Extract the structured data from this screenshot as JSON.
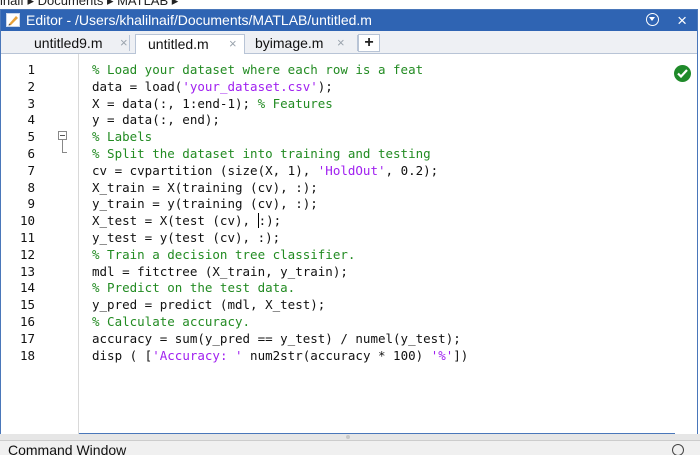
{
  "breadcrumb": "inaif  ▸  Documents  ▸  MATLAB  ▸",
  "editor": {
    "title": "Editor - /Users/khalilnaif/Documents/MATLAB/untitled.m",
    "close_glyph": "×"
  },
  "tabs": [
    {
      "label": "untitled9.m",
      "close": "×",
      "active": false
    },
    {
      "label": "untitled.m",
      "close": "×",
      "active": true
    },
    {
      "label": "byimage.m",
      "close": "×",
      "active": false
    }
  ],
  "new_tab_label": "+",
  "line_numbers": [
    "1",
    "2",
    "3",
    "4",
    "5",
    "6",
    "7",
    "8",
    "9",
    "10",
    "11",
    "12",
    "13",
    "14",
    "15",
    "16",
    "17",
    "18"
  ],
  "code": [
    {
      "segments": [
        {
          "t": "% Load your dataset where each row is a feat",
          "k": "c"
        }
      ]
    },
    {
      "segments": [
        {
          "t": "data = load(",
          "k": ""
        },
        {
          "t": "'your_dataset.csv'",
          "k": "s"
        },
        {
          "t": ");",
          "k": ""
        }
      ]
    },
    {
      "segments": [
        {
          "t": "X = data(:, 1:end-1); ",
          "k": ""
        },
        {
          "t": "% Features",
          "k": "c"
        }
      ]
    },
    {
      "segments": [
        {
          "t": "y = data(:, end);",
          "k": ""
        }
      ]
    },
    {
      "segments": [
        {
          "t": "% Labels",
          "k": "c"
        }
      ]
    },
    {
      "segments": [
        {
          "t": "% Split the dataset into training and testing",
          "k": "c"
        }
      ]
    },
    {
      "segments": [
        {
          "t": "cv = cvpartition (size(X, 1), ",
          "k": ""
        },
        {
          "t": "'HoldOut'",
          "k": "s"
        },
        {
          "t": ", 0.2);",
          "k": ""
        }
      ]
    },
    {
      "segments": [
        {
          "t": "X_train = X(training (cv), :);",
          "k": ""
        }
      ]
    },
    {
      "segments": [
        {
          "t": "y_train = y(training (cv), :);",
          "k": ""
        }
      ]
    },
    {
      "segments": [
        {
          "t": "X_test = X(test (cv), ",
          "k": ""
        },
        {
          "t": ":",
          "k": "caret"
        },
        {
          "t": ");",
          "k": ""
        }
      ]
    },
    {
      "segments": [
        {
          "t": "y_test = y(test (cv), :);",
          "k": ""
        }
      ]
    },
    {
      "segments": [
        {
          "t": "% Train a decision tree classifier.",
          "k": "c"
        }
      ]
    },
    {
      "segments": [
        {
          "t": "mdl = fitctree (X_train, y_train);",
          "k": ""
        }
      ]
    },
    {
      "segments": [
        {
          "t": "% Predict on the test data.",
          "k": "c"
        }
      ]
    },
    {
      "segments": [
        {
          "t": "y_pred = predict (mdl, X_test);",
          "k": ""
        }
      ]
    },
    {
      "segments": [
        {
          "t": "% Calculate accuracy.",
          "k": "c"
        }
      ]
    },
    {
      "segments": [
        {
          "t": "accuracy = sum(y_pred == y_test) / numel(y_test);",
          "k": ""
        }
      ]
    },
    {
      "segments": [
        {
          "t": "disp ( [",
          "k": ""
        },
        {
          "t": "'Accuracy: '",
          "k": "s"
        },
        {
          "t": " num2str(accuracy * 100) ",
          "k": ""
        },
        {
          "t": "'%'",
          "k": "s"
        },
        {
          "t": "])",
          "k": ""
        }
      ]
    }
  ],
  "command_window": {
    "label": "Command Window"
  },
  "colors": {
    "titlebar": "#2f64b3",
    "comment": "#228b22",
    "string": "#a020f0",
    "ok": "#1f8a2a"
  }
}
